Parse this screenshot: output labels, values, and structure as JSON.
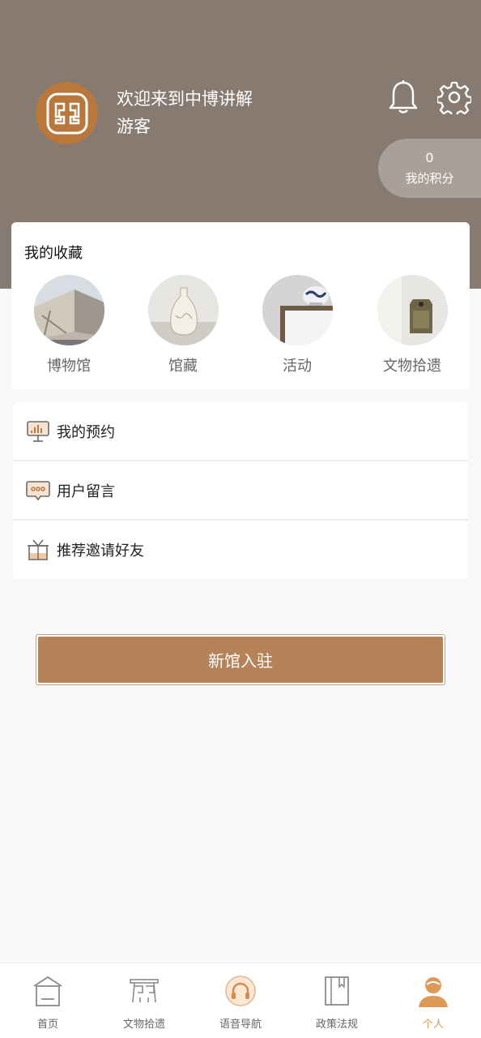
{
  "header": {
    "welcome": "欢迎来到中博讲解",
    "username": "游客",
    "icons": [
      "logo-icon",
      "bell-icon",
      "gear-icon"
    ],
    "points": {
      "value": "0",
      "label": "我的积分"
    }
  },
  "favorites": {
    "title": "我的收藏",
    "items": [
      {
        "label": "博物馆",
        "thumb": "museum-building"
      },
      {
        "label": "馆藏",
        "thumb": "vase"
      },
      {
        "label": "活动",
        "thumb": "exhibit"
      },
      {
        "label": "文物拾遗",
        "thumb": "artifact"
      }
    ]
  },
  "menu": {
    "items": [
      {
        "label": "我的预约",
        "icon": "reservation-icon"
      },
      {
        "label": "用户留言",
        "icon": "message-icon"
      },
      {
        "label": "推荐邀请好友",
        "icon": "gift-icon"
      }
    ]
  },
  "join_button": "新馆入驻",
  "tabbar": {
    "items": [
      {
        "label": "首页",
        "icon": "home-icon"
      },
      {
        "label": "文物拾遗",
        "icon": "relics-icon"
      },
      {
        "label": "语音导航",
        "icon": "headphones-icon"
      },
      {
        "label": "政策法规",
        "icon": "book-icon"
      },
      {
        "label": "个人",
        "icon": "user-icon"
      }
    ],
    "active_index": 4
  },
  "colors": {
    "header_bg": "#877a70",
    "accent": "#b58357",
    "active_tab": "#d99a5e",
    "avatar_bg": "#b9773c"
  }
}
